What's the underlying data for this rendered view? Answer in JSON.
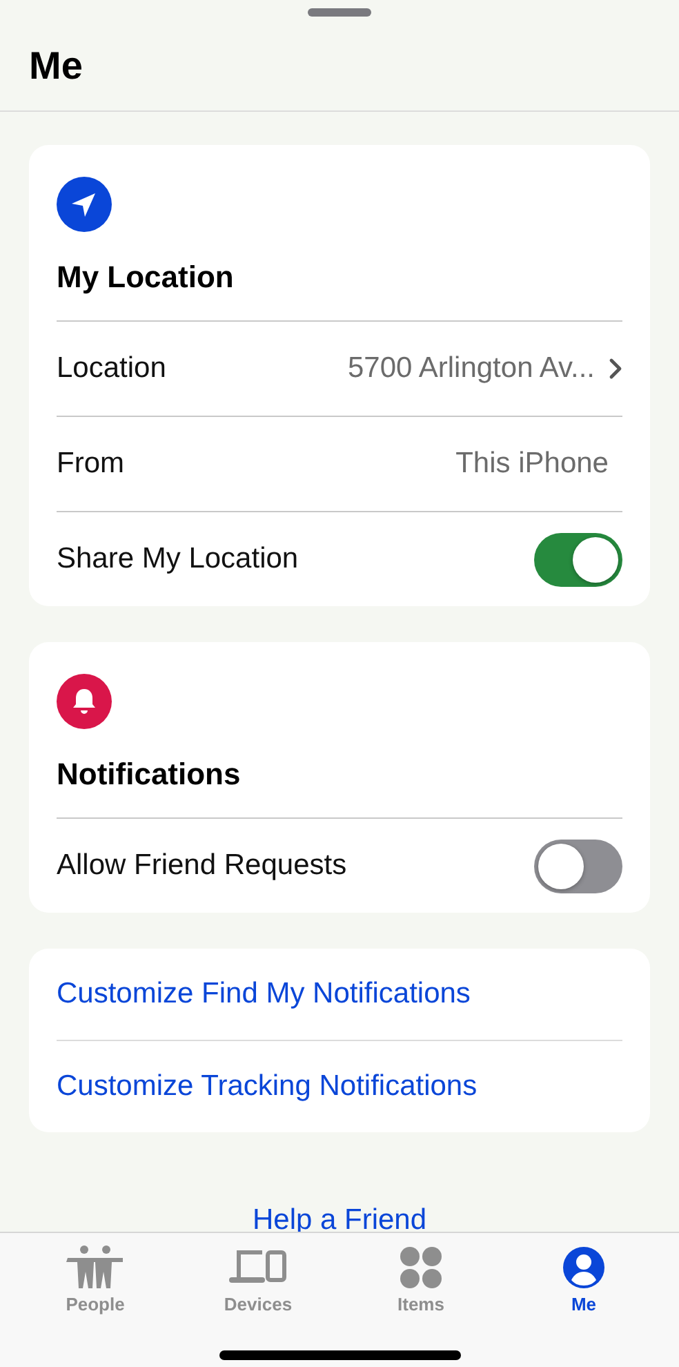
{
  "header": {
    "title": "Me"
  },
  "sections": [
    {
      "title": "My Location",
      "rows": [
        {
          "kind": "link",
          "label": "Location",
          "value": "5700 Arlington Av..."
        },
        {
          "kind": "value",
          "label": "From",
          "value": "This iPhone"
        },
        {
          "kind": "toggle",
          "label": "Share My Location",
          "on": true
        }
      ]
    },
    {
      "title": "Notifications",
      "rows": [
        {
          "kind": "toggle",
          "label": "Allow Friend Requests",
          "on": false
        }
      ]
    }
  ],
  "links": [
    "Customize Find My Notifications",
    "Customize Tracking Notifications"
  ],
  "help_link": "Help a Friend",
  "tabs": [
    {
      "label": "People",
      "selected": false
    },
    {
      "label": "Devices",
      "selected": false
    },
    {
      "label": "Items",
      "selected": false
    },
    {
      "label": "Me",
      "selected": true
    }
  ]
}
